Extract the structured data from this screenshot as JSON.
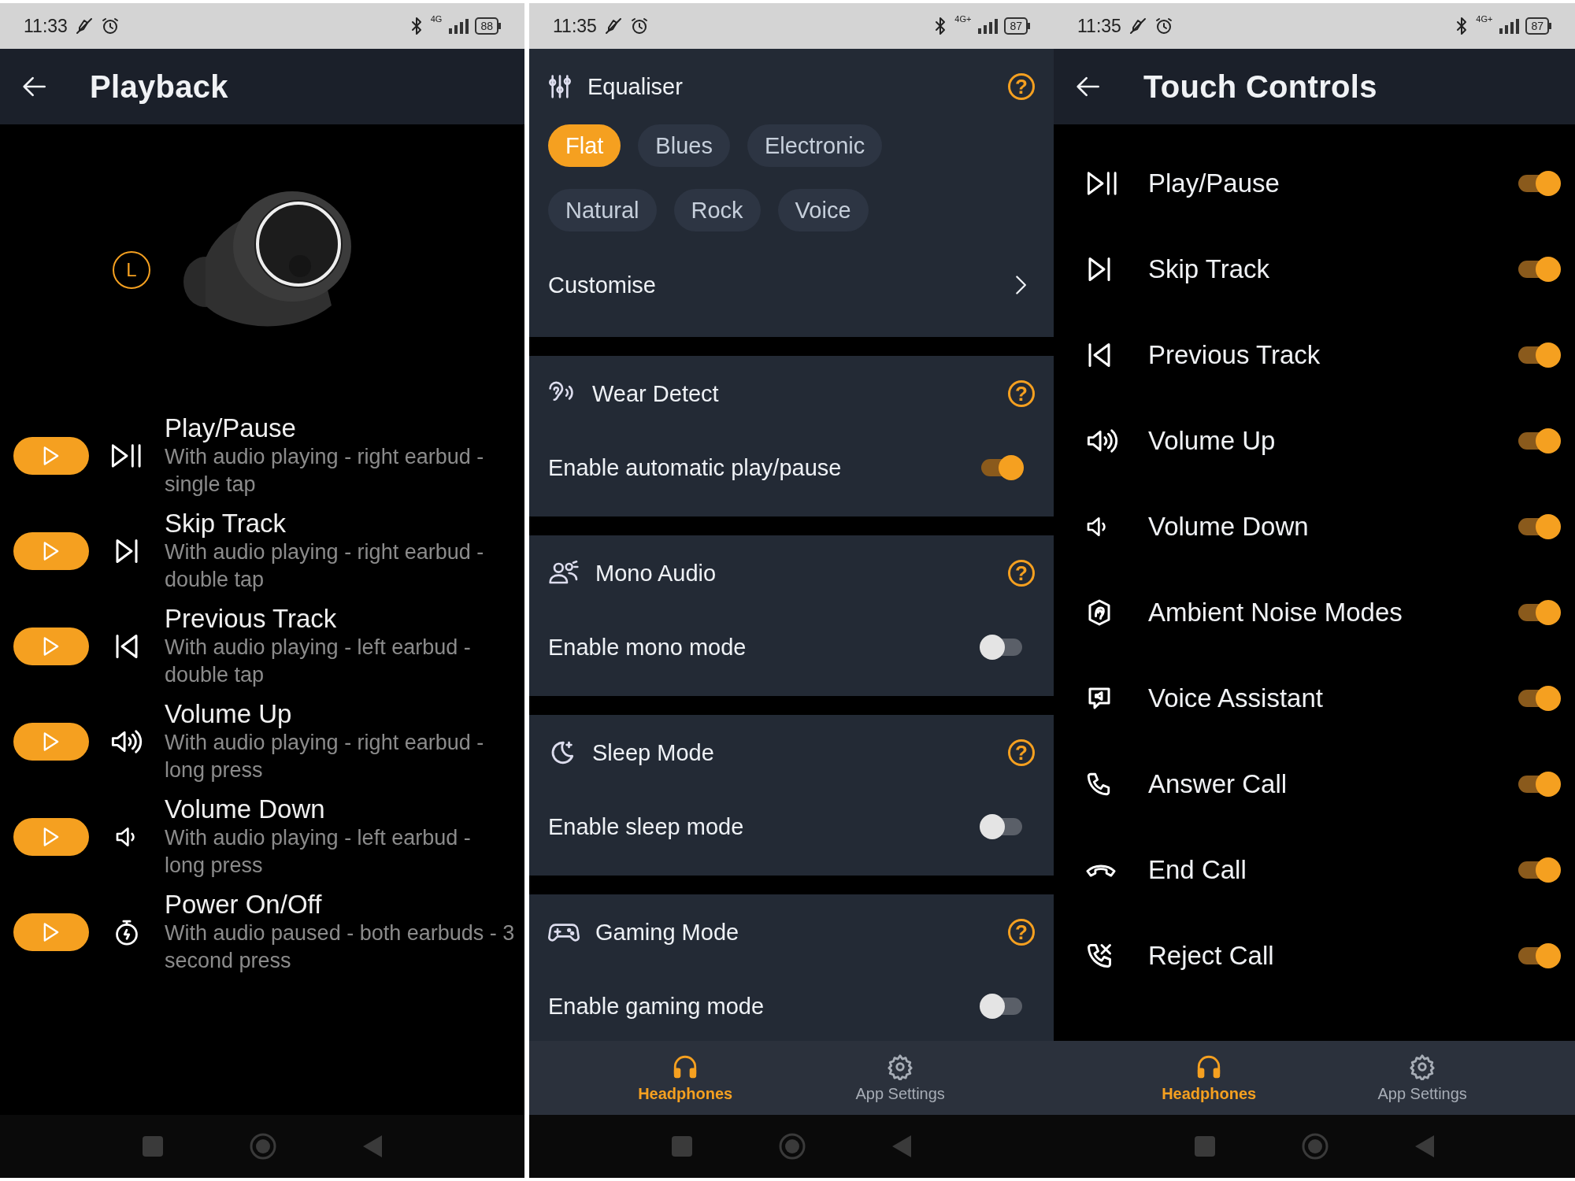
{
  "screens": [
    {
      "status_bar": {
        "time": "11:33",
        "network": "4G",
        "battery": "88"
      },
      "header": {
        "title": "Playback"
      },
      "earbud": {
        "side": "L"
      },
      "actions": [
        {
          "title": "Play/Pause",
          "description": "With audio playing - right earbud - single tap"
        },
        {
          "title": "Skip Track",
          "description": "With audio playing - right earbud - double tap"
        },
        {
          "title": "Previous Track",
          "description": "With audio playing - left earbud - double tap"
        },
        {
          "title": "Volume Up",
          "description": "With audio playing - right earbud - long press"
        },
        {
          "title": "Volume Down",
          "description": "With audio playing - left earbud - long press"
        },
        {
          "title": "Power On/Off",
          "description": "With audio paused - both earbuds - 3 second press"
        }
      ]
    },
    {
      "status_bar": {
        "time": "11:35",
        "network": "4G+",
        "battery": "87"
      },
      "equaliser": {
        "title": "Equaliser",
        "help": "?",
        "presets": [
          {
            "label": "Flat",
            "selected": true
          },
          {
            "label": "Blues",
            "selected": false
          },
          {
            "label": "Electronic",
            "selected": false
          },
          {
            "label": "Natural",
            "selected": false
          },
          {
            "label": "Rock",
            "selected": false
          },
          {
            "label": "Voice",
            "selected": false
          }
        ],
        "customise": "Customise"
      },
      "features": [
        {
          "title": "Wear Detect",
          "help": "?",
          "setting": "Enable automatic play/pause",
          "on": true
        },
        {
          "title": "Mono Audio",
          "help": "?",
          "setting": "Enable mono mode",
          "on": false
        },
        {
          "title": "Sleep Mode",
          "help": "?",
          "setting": "Enable sleep mode",
          "on": false
        },
        {
          "title": "Gaming Mode",
          "help": "?",
          "setting": "Enable gaming mode",
          "on": false
        }
      ],
      "nav": [
        {
          "label": "Headphones",
          "selected": true
        },
        {
          "label": "App Settings",
          "selected": false
        }
      ]
    },
    {
      "status_bar": {
        "time": "11:35",
        "network": "4G+",
        "battery": "87"
      },
      "header": {
        "title": "Touch Controls"
      },
      "controls": [
        {
          "label": "Play/Pause",
          "on": true
        },
        {
          "label": "Skip Track",
          "on": true
        },
        {
          "label": "Previous Track",
          "on": true
        },
        {
          "label": "Volume Up",
          "on": true
        },
        {
          "label": "Volume Down",
          "on": true
        },
        {
          "label": "Ambient Noise Modes",
          "on": true
        },
        {
          "label": "Voice Assistant",
          "on": true
        },
        {
          "label": "Answer Call",
          "on": true
        },
        {
          "label": "End Call",
          "on": true
        },
        {
          "label": "Reject Call",
          "on": true
        }
      ],
      "nav": [
        {
          "label": "Headphones",
          "selected": true
        },
        {
          "label": "App Settings",
          "selected": false
        }
      ]
    }
  ]
}
